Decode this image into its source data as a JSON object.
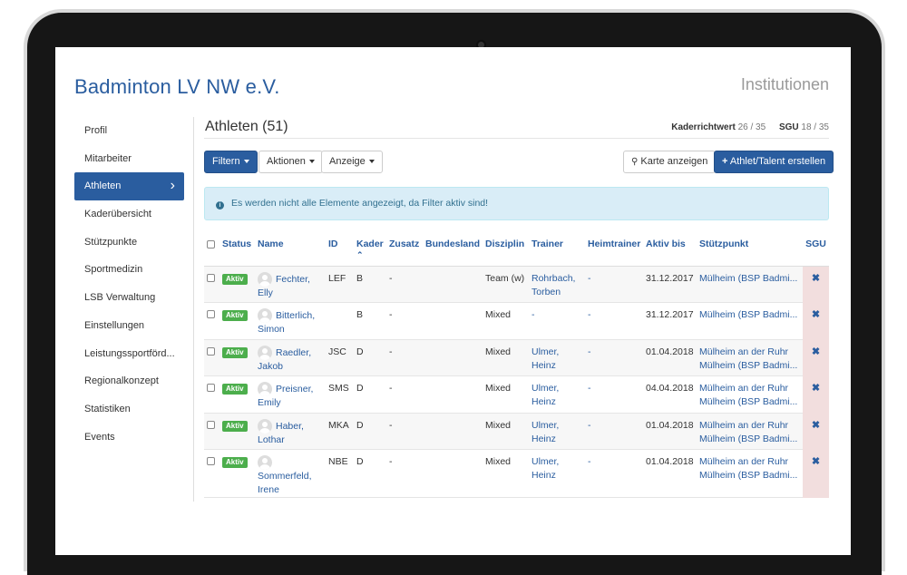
{
  "header": {
    "brand": "Badminton LV NW e.V.",
    "section": "Institutionen"
  },
  "sidebar": {
    "items": [
      {
        "label": "Profil",
        "active": false
      },
      {
        "label": "Mitarbeiter",
        "active": false
      },
      {
        "label": "Athleten",
        "active": true
      },
      {
        "label": "Kaderübersicht",
        "active": false
      },
      {
        "label": "Stützpunkte",
        "active": false
      },
      {
        "label": "Sportmedizin",
        "active": false
      },
      {
        "label": "LSB Verwaltung",
        "active": false
      },
      {
        "label": "Einstellungen",
        "active": false
      },
      {
        "label": "Leistungssportförd...",
        "active": false
      },
      {
        "label": "Regionalkonzept",
        "active": false
      },
      {
        "label": "Statistiken",
        "active": false
      },
      {
        "label": "Events",
        "active": false
      }
    ]
  },
  "main": {
    "title": "Athleten (51)",
    "kaderrichtwert_label": "Kaderrichtwert",
    "kaderrichtwert_value": "26 / 35",
    "sgu_label": "SGU",
    "sgu_value": "18 / 35"
  },
  "toolbar": {
    "filter": "Filtern",
    "actions": "Aktionen",
    "view": "Anzeige",
    "map": "Karte anzeigen",
    "create": "Athlet/Talent erstellen"
  },
  "alert": {
    "text": "Es werden nicht alle Elemente angezeigt, da Filter aktiv sind!"
  },
  "table": {
    "headers": {
      "status": "Status",
      "name": "Name",
      "id": "ID",
      "kader": "Kader",
      "zusatz": "Zusatz",
      "bundesland": "Bundesland",
      "disziplin": "Disziplin",
      "trainer": "Trainer",
      "heimtrainer": "Heimtrainer",
      "aktiv_bis": "Aktiv bis",
      "stuetzpunkt": "Stützpunkt",
      "sgu": "SGU"
    },
    "rows": [
      {
        "status": "Aktiv",
        "name1": "Fechter,",
        "name2": "Elly",
        "id": "LEF",
        "kader": "B",
        "zusatz": "-",
        "bundesland": "",
        "disziplin": "Team (w)",
        "trainer1": "Rohrbach,",
        "trainer2": "Torben",
        "heimtrainer": "-",
        "aktiv_bis": "31.12.2017",
        "stp1": "Mülheim (BSP Badmi...",
        "stp2": "",
        "sgu": "✖"
      },
      {
        "status": "Aktiv",
        "name1": "Bitterlich,",
        "name2": "Simon",
        "id": "",
        "kader": "B",
        "zusatz": "-",
        "bundesland": "",
        "disziplin": "Mixed",
        "trainer1": "-",
        "trainer2": "",
        "heimtrainer": "-",
        "aktiv_bis": "31.12.2017",
        "stp1": "Mülheim (BSP Badmi...",
        "stp2": "",
        "sgu": "✖"
      },
      {
        "status": "Aktiv",
        "name1": "Raedler,",
        "name2": "Jakob",
        "id": "JSC",
        "kader": "D",
        "zusatz": "-",
        "bundesland": "",
        "disziplin": "Mixed",
        "trainer1": "Ulmer,",
        "trainer2": "Heinz",
        "heimtrainer": "-",
        "aktiv_bis": "01.04.2018",
        "stp1": "Mülheim an der Ruhr",
        "stp2": "Mülheim (BSP Badmi...",
        "sgu": "✖"
      },
      {
        "status": "Aktiv",
        "name1": "Preisner,",
        "name2": "Emily",
        "id": "SMS",
        "kader": "D",
        "zusatz": "-",
        "bundesland": "",
        "disziplin": "Mixed",
        "trainer1": "Ulmer,",
        "trainer2": "Heinz",
        "heimtrainer": "-",
        "aktiv_bis": "04.04.2018",
        "stp1": "Mülheim an der Ruhr",
        "stp2": "Mülheim (BSP Badmi...",
        "sgu": "✖"
      },
      {
        "status": "Aktiv",
        "name1": "Haber,",
        "name2": "Lothar",
        "id": "MKA",
        "kader": "D",
        "zusatz": "-",
        "bundesland": "",
        "disziplin": "Mixed",
        "trainer1": "Ulmer,",
        "trainer2": "Heinz",
        "heimtrainer": "-",
        "aktiv_bis": "01.04.2018",
        "stp1": "Mülheim an der Ruhr",
        "stp2": "Mülheim (BSP Badmi...",
        "sgu": "✖"
      },
      {
        "status": "Aktiv",
        "name1": "Sommerfeld,",
        "name2": "Irene",
        "id": "NBE",
        "kader": "D",
        "zusatz": "-",
        "bundesland": "",
        "disziplin": "Mixed",
        "trainer1": "Ulmer,",
        "trainer2": "Heinz",
        "heimtrainer": "-",
        "aktiv_bis": "01.04.2018",
        "stp1": "Mülheim an der Ruhr",
        "stp2": "Mülheim (BSP Badmi...",
        "sgu": "✖"
      }
    ]
  }
}
